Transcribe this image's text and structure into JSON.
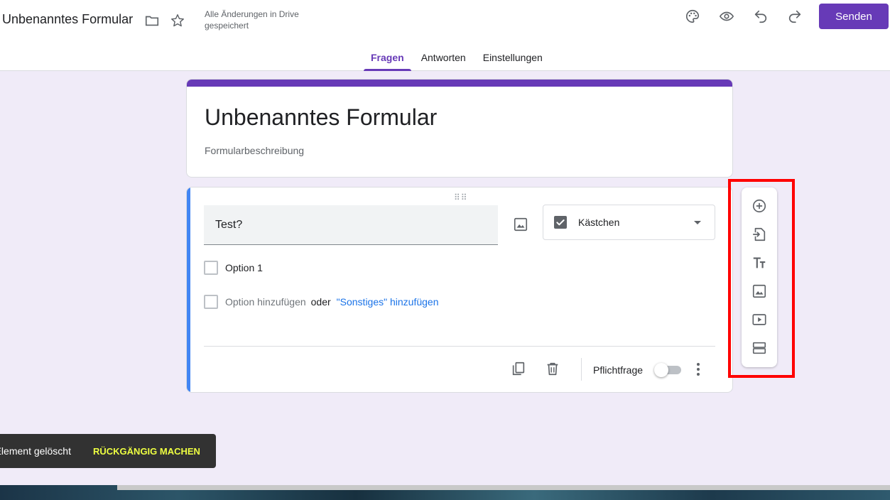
{
  "header": {
    "doc_title": "Unbenanntes Formular",
    "save_status": "Alle Änderungen in Drive gespeichert",
    "send_label": "Senden",
    "icons": [
      "folder-icon",
      "star-icon",
      "palette-icon",
      "eye-icon",
      "undo-icon",
      "redo-icon"
    ]
  },
  "tabs": [
    {
      "label": "Fragen",
      "active": true
    },
    {
      "label": "Antworten",
      "active": false
    },
    {
      "label": "Einstellungen",
      "active": false
    }
  ],
  "form": {
    "title": "Unbenanntes Formular",
    "description_placeholder": "Formularbeschreibung"
  },
  "question": {
    "text": "Test?",
    "type_label": "Kästchen",
    "options": [
      "Option 1"
    ],
    "add_option": "Option hinzufügen",
    "or": "oder",
    "add_other": "\"Sonstiges\" hinzufügen",
    "required_label": "Pflichtfrage",
    "required": false
  },
  "toolbar": {
    "items": [
      "add-question-icon",
      "import-questions-icon",
      "add-title-icon",
      "add-image-icon",
      "add-video-icon",
      "add-section-icon"
    ]
  },
  "snackbar": {
    "message": "Element gelöscht",
    "action": "RÜCKGÄNGIG MACHEN"
  },
  "colors": {
    "accent": "#673ab7",
    "background": "#f0ebf8",
    "question_accent": "#4285f4",
    "link": "#1a73e8",
    "highlight": "#ff0000",
    "snack_action": "#eeff41"
  }
}
